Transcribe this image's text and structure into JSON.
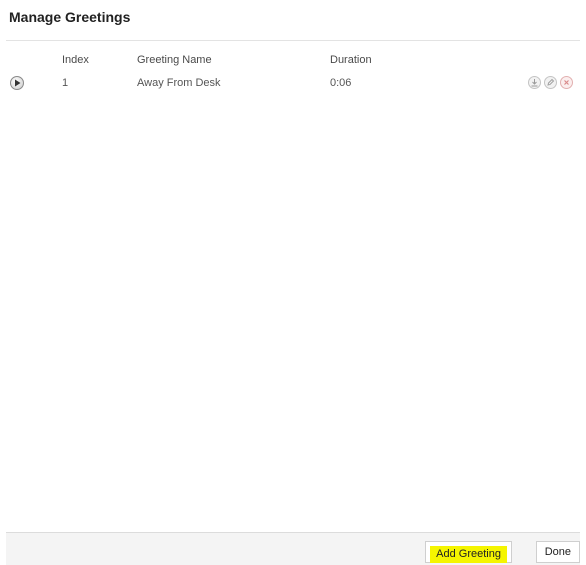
{
  "dialog": {
    "title": "Manage Greetings"
  },
  "table": {
    "columns": {
      "index": "Index",
      "name": "Greeting Name",
      "duration": "Duration"
    },
    "rows": [
      {
        "index": "1",
        "name": "Away From Desk",
        "duration": "0:06"
      }
    ]
  },
  "icons": {
    "play": "play-icon",
    "download": "download-icon",
    "edit": "edit-icon",
    "delete": "delete-icon"
  },
  "colors": {
    "highlight": "#f5f500",
    "delete": "#d98a8a"
  },
  "footer": {
    "add_label": "Add Greeting",
    "done_label": "Done"
  }
}
